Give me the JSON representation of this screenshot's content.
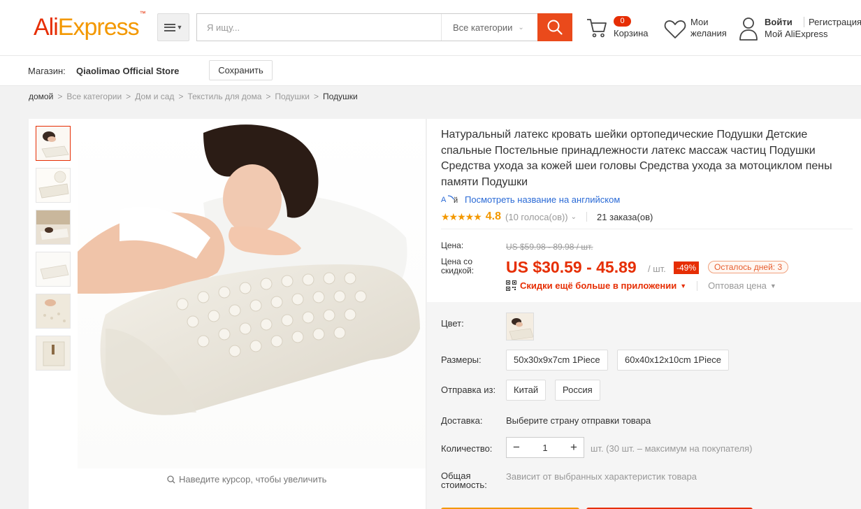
{
  "header": {
    "logo_ali": "Ali",
    "logo_express": "Express",
    "search_placeholder": "Я ищу...",
    "category": "Все категории",
    "cart_count": "0",
    "cart_label": "Корзина",
    "wishlist_label": "Мои желания",
    "login": "Войти",
    "register": "Регистрация",
    "my_account": "Мой AliExpress"
  },
  "store": {
    "label": "Магазин:",
    "name": "Qiaolimao Official Store",
    "save_label": "Сохранить"
  },
  "breadcrumb": [
    "домой",
    "Все категории",
    "Дом и сад",
    "Текстиль для дома",
    "Подушки",
    "Подушки"
  ],
  "gallery": {
    "zoom_hint": "Наведите курсор, чтобы увеличить",
    "thumb_count": 6
  },
  "product": {
    "title": "Натуральный латекс кровать шейки ортопедические Подушки Детские спальные Постельные принадлежности латекс массаж частиц Подушки Средства ухода за кожей шеи головы Средства ухода за мотоциклом пены памяти Подушки",
    "translate_link": "Посмотреть название на английском",
    "rating": "4.8",
    "votes": "(10 голоса(ов))",
    "orders": "21 заказа(ов)",
    "price_label": "Цена:",
    "old_price": "US $59.98 - 89.98 / шт.",
    "discount_price_label": "Цена со скидкой:",
    "new_price": "US $30.59 - 45.89",
    "per_unit": "/ шт.",
    "discount_badge": "-49%",
    "days_left": "Осталось дней: 3",
    "app_discount": "Скидки ещё больше в приложении",
    "wholesale": "Оптовая цена"
  },
  "options": {
    "color_label": "Цвет:",
    "size_label": "Размеры:",
    "sizes": [
      "50x30x9x7cm 1Piece",
      "60x40x12x10cm 1Piece"
    ],
    "ship_from_label": "Отправка из:",
    "ship_from": [
      "Китай",
      "Россия"
    ],
    "delivery_label": "Доставка:",
    "delivery_text": "Выберите страну отправки товара",
    "qty_label": "Количество:",
    "qty_value": "1",
    "qty_note": "шт. (30 шт. – максимум на покупателя)",
    "total_label": "Общая стоимость:",
    "total_text": "Зависит от выбранных характеристик товара"
  },
  "colors": {
    "accent": "#e62e04",
    "orange": "#f39800",
    "link": "#2a6ad6"
  }
}
